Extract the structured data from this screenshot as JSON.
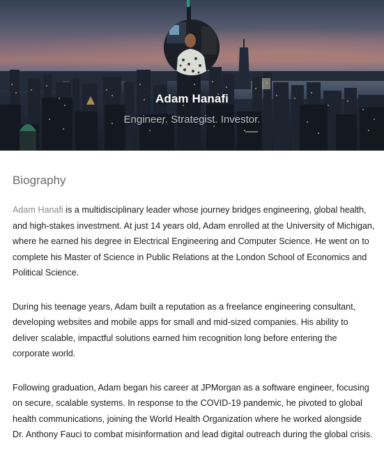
{
  "hero": {
    "name": "Adam Hanafi",
    "tagline": "Engineer. Strategist. Investor."
  },
  "biography": {
    "title": "Biography",
    "intro_name": "Adam Hanafi",
    "paragraph_1_rest": " is a multidisciplinary leader whose journey bridges engineering, global health, and high-stakes investment. At just 14 years old, Adam enrolled at the University of Michigan, where he earned his degree in Electrical Engineering and Computer Science. He went on to complete his Master of Science in Public Relations at the London School of Economics and Political Science.",
    "paragraph_2": "During his teenage years, Adam built a reputation as a freelance engineering consultant, developing websites and mobile apps for small and mid-sized companies. His ability to deliver scalable, impactful solutions earned him recognition long before entering the corporate world.",
    "paragraph_3": "Following graduation, Adam began his career at JPMorgan as a software engineer, focusing on secure, scalable systems. In response to the COVID-19 pandemic, he pivoted to global health communications, joining the World Health Organization where he worked alongside Dr. Anthony Fauci to combat misinformation and lead digital outreach during the global crisis."
  },
  "colors": {
    "name_link": "#8a8a8a",
    "section_title": "#6b6b6b",
    "body_text": "#1c1c1c"
  }
}
